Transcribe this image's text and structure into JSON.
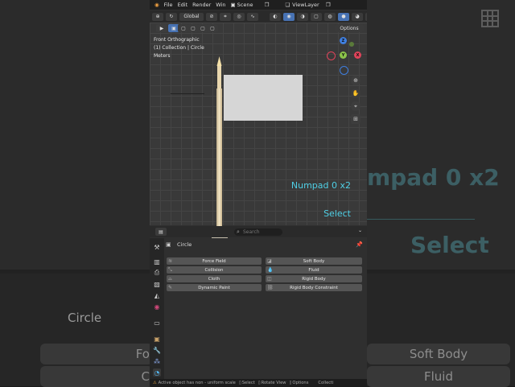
{
  "background": {
    "hint_numpad": "mpad 0 x2",
    "hint_select": "Select",
    "object_name": "Circle",
    "force_field_partial": "Fo",
    "collision_partial": "C",
    "soft_body": "Soft Body",
    "fluid": "Fluid"
  },
  "topbar": {
    "menus": [
      "File",
      "Edit",
      "Render",
      "Win"
    ],
    "scene": "Scene",
    "view_layer": "ViewLayer"
  },
  "toolbar": {
    "orientation": "Global"
  },
  "viewport": {
    "view_name": "Front Orthographic",
    "collection": "(1) Collection | Circle",
    "units": "Meters",
    "options_label": "Options",
    "gizmo": {
      "z": "Z",
      "y": "Y",
      "x": "X"
    },
    "hint_numpad": "Numpad 0 x2",
    "hint_select": "Select"
  },
  "properties": {
    "search_placeholder": "Search",
    "object_name": "Circle",
    "buttons_left": [
      "Force Field",
      "Collision",
      "Cloth",
      "Dynamic Paint"
    ],
    "buttons_right": [
      "Soft Body",
      "Fluid",
      "Rigid Body",
      "Rigid Body Constraint"
    ]
  },
  "statusbar": {
    "warning": "Active object has non - uniform scale",
    "select": "Select",
    "rotate": "Rotate View",
    "options": "Options",
    "collection": "Collecti"
  },
  "colors": {
    "accent": "#4772b3",
    "hint": "#4fd0e6",
    "x_axis": "#e0435a",
    "y_axis": "#8bc34a",
    "z_axis": "#3f7fe0"
  }
}
